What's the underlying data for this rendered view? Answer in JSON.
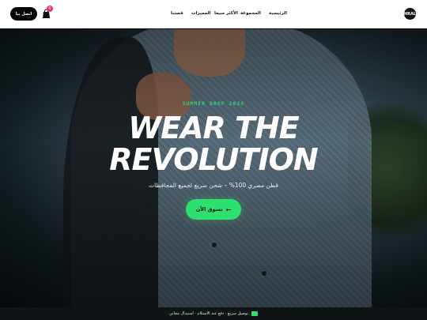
{
  "header": {
    "contact_label": "اتصل بنا",
    "cart_count": "0",
    "nav": [
      "الرئيسية",
      "المجموعة",
      "الأكثر مبيعا",
      "المميزات",
      "قصتنا"
    ],
    "logo_text": "HRAL"
  },
  "hero": {
    "kicker": "SUMMER DROP 2026",
    "headline_line1": "WEAR THE",
    "headline_line2": "REVOLUTION",
    "subline": "قطن مصري 100% – شحن سريع لجميع المحافظات",
    "cta_label": "تسوق الآن",
    "cta_icon": "arrow-left-icon"
  },
  "bottom_bar": {
    "text": "توصيل سريع · دفع عند الاستلام · استبدال مجاني",
    "icon": "truck-icon"
  },
  "colors": {
    "accent": "#2ee06f",
    "badge": "#e6336b",
    "header_bg": "#ffffff",
    "dark": "#0b0f12"
  }
}
